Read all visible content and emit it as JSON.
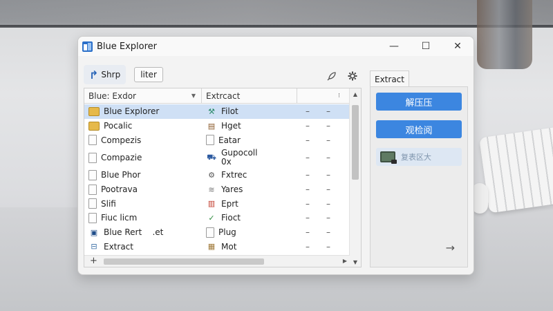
{
  "window": {
    "title": "Blue Explorer",
    "controls": {
      "minimize": "—",
      "maximize": "☐",
      "close": "✕"
    }
  },
  "toolbar": {
    "nav_label": "Shrp",
    "filter_label": "liter",
    "icons": [
      "brush-icon",
      "gear-icon"
    ]
  },
  "filelist": {
    "columns": [
      "Blue: Exdor",
      "Extrcact",
      "⁝"
    ],
    "rows": [
      {
        "name": "Blue Explorer",
        "icon": "folder-icon",
        "type": "Filot",
        "type_icon": "tools-icon",
        "d1": "–",
        "d2": "–",
        "selected": true
      },
      {
        "name": "Pocalic",
        "icon": "folder-icon",
        "type": "Hget",
        "type_icon": "drawer-icon",
        "d1": "–",
        "d2": "–",
        "selected": false
      },
      {
        "name": "Compezis",
        "icon": "document-icon",
        "type": "Eatar",
        "type_icon": "document-icon",
        "d1": "–",
        "d2": "–",
        "selected": false
      },
      {
        "name": "Compazie",
        "icon": "document-icon",
        "type": "Gupocoll\n0x",
        "type_icon": "truck-icon",
        "d1": "–",
        "d2": "–",
        "selected": false
      },
      {
        "name": "Blue Phor",
        "icon": "document-icon",
        "type": "Fxtrec",
        "type_icon": "plug-icon",
        "d1": "–",
        "d2": "–",
        "selected": false
      },
      {
        "name": "Pootrava",
        "icon": "document-icon",
        "type": "Yares",
        "type_icon": "papers-icon",
        "d1": "–",
        "d2": "–",
        "selected": false
      },
      {
        "name": "Slifi",
        "icon": "document-icon",
        "type": "Eprt",
        "type_icon": "books-icon",
        "d1": "–",
        "d2": "–",
        "selected": false
      },
      {
        "name": "Fiuc licm",
        "icon": "document-icon",
        "type": "Fioct",
        "type_icon": "check-icon",
        "d1": "–",
        "d2": "–",
        "selected": false
      },
      {
        "name": "Blue Rert    .et",
        "icon": "package-icon",
        "type": "Plug",
        "type_icon": "document-icon",
        "d1": "–",
        "d2": "–",
        "selected": false
      },
      {
        "name": "Extract",
        "icon": "ruler-icon",
        "type": "Mot",
        "type_icon": "box-icon",
        "d1": "–",
        "d2": "–",
        "selected": false
      }
    ]
  },
  "side_panel": {
    "tab_label": "Extract",
    "button1": "解压压",
    "button2": "观检阅",
    "button3": "复表区大"
  },
  "colors": {
    "accent": "#3c86e0",
    "selection": "#cfe0f5"
  }
}
